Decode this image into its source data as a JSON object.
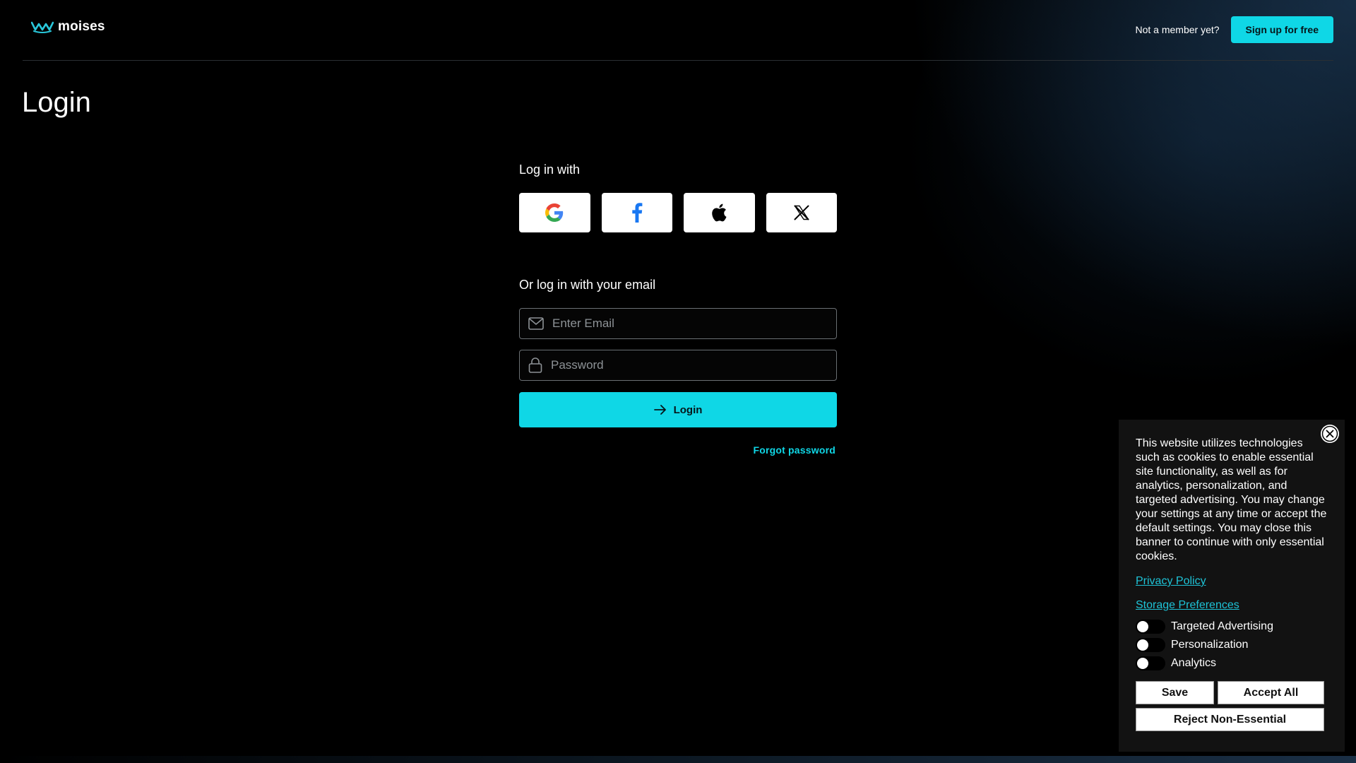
{
  "header": {
    "logo_text": "moises",
    "not_member": "Not a member yet?",
    "signup_label": "Sign up for free"
  },
  "page": {
    "title": "Login"
  },
  "social": {
    "label": "Log in with",
    "providers": [
      "google-icon",
      "facebook-icon",
      "apple-icon",
      "x-icon"
    ]
  },
  "email_login": {
    "label": "Or log in with your email",
    "email_placeholder": "Enter Email",
    "password_placeholder": "Password",
    "login_label": "Login",
    "forgot_label": "Forgot password"
  },
  "cookie": {
    "text": "This website utilizes technologies such as cookies to enable essential site functionality, as well as for analytics, personalization, and targeted advertising. You may change your settings at any time or accept the default settings. You may close this banner to continue with only essential cookies.",
    "privacy_policy": "Privacy Policy",
    "storage_preferences": "Storage Preferences",
    "toggles": [
      "Targeted Advertising",
      "Personalization",
      "Analytics"
    ],
    "save": "Save",
    "accept_all": "Accept All",
    "reject": "Reject Non-Essential"
  },
  "colors": {
    "accent": "#0fd7e6",
    "background": "#000000",
    "cookie_bg": "#121212",
    "link": "#1ec3d7"
  }
}
